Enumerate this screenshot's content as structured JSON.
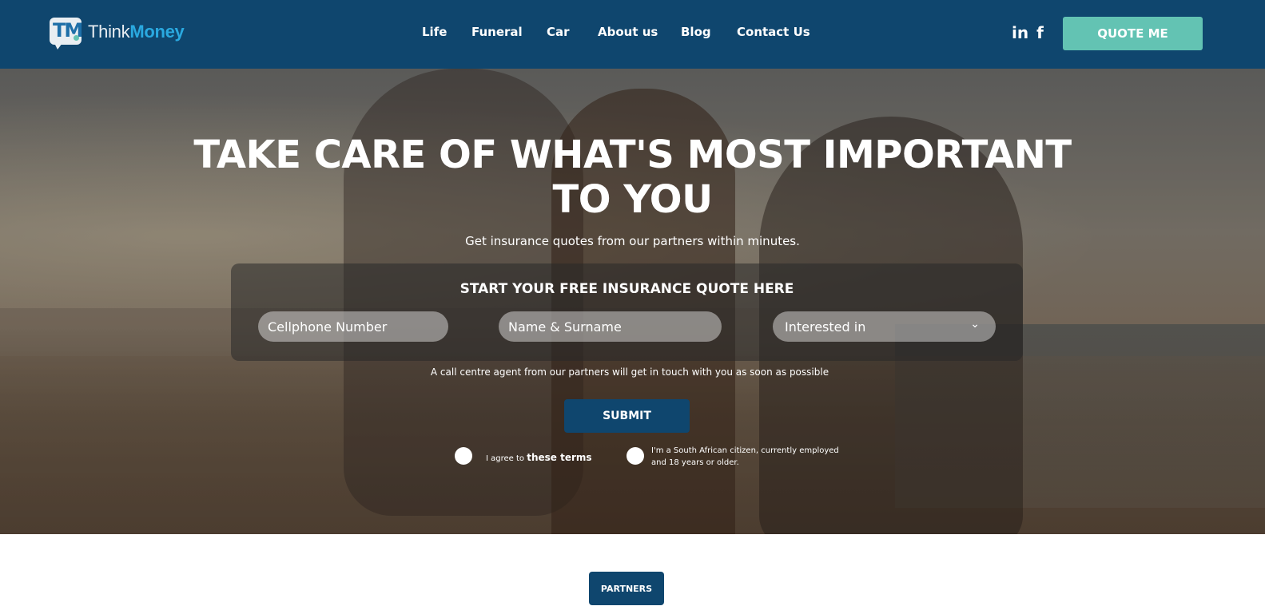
{
  "brand": {
    "name_part1": "Think",
    "name_part2": "Money",
    "logo_letters": "TM"
  },
  "nav": {
    "items": [
      "Life",
      "Funeral",
      "Car",
      "About us",
      "Blog",
      "Contact Us"
    ]
  },
  "social": {
    "linkedin": "in",
    "facebook": "f"
  },
  "header": {
    "quote_button": "QUOTE ME"
  },
  "hero": {
    "title_line1": "TAKE CARE OF WHAT'S MOST IMPORTANT",
    "title_line2": "TO YOU",
    "subtitle": "Get insurance quotes from our partners within minutes."
  },
  "quote_form": {
    "title": "START YOUR FREE INSURANCE QUOTE HERE",
    "cellphone_placeholder": "Cellphone Number",
    "name_placeholder": "Name & Surname",
    "interest_selected": "Interested in",
    "note": "A call centre agent from our partners will get in touch with you as soon as possible",
    "submit_label": "SUBMIT",
    "terms_prefix": "I agree to ",
    "terms_link": "these terms",
    "citizen_line1": "I'm a South African citizen, currently employed",
    "citizen_line2": "and 18 years or older."
  },
  "partners": {
    "button_label": "PARTNERS"
  },
  "colors": {
    "header_bg": "#0f466e",
    "accent": "#63c3b3",
    "brand_blue": "#2aa9e0"
  }
}
